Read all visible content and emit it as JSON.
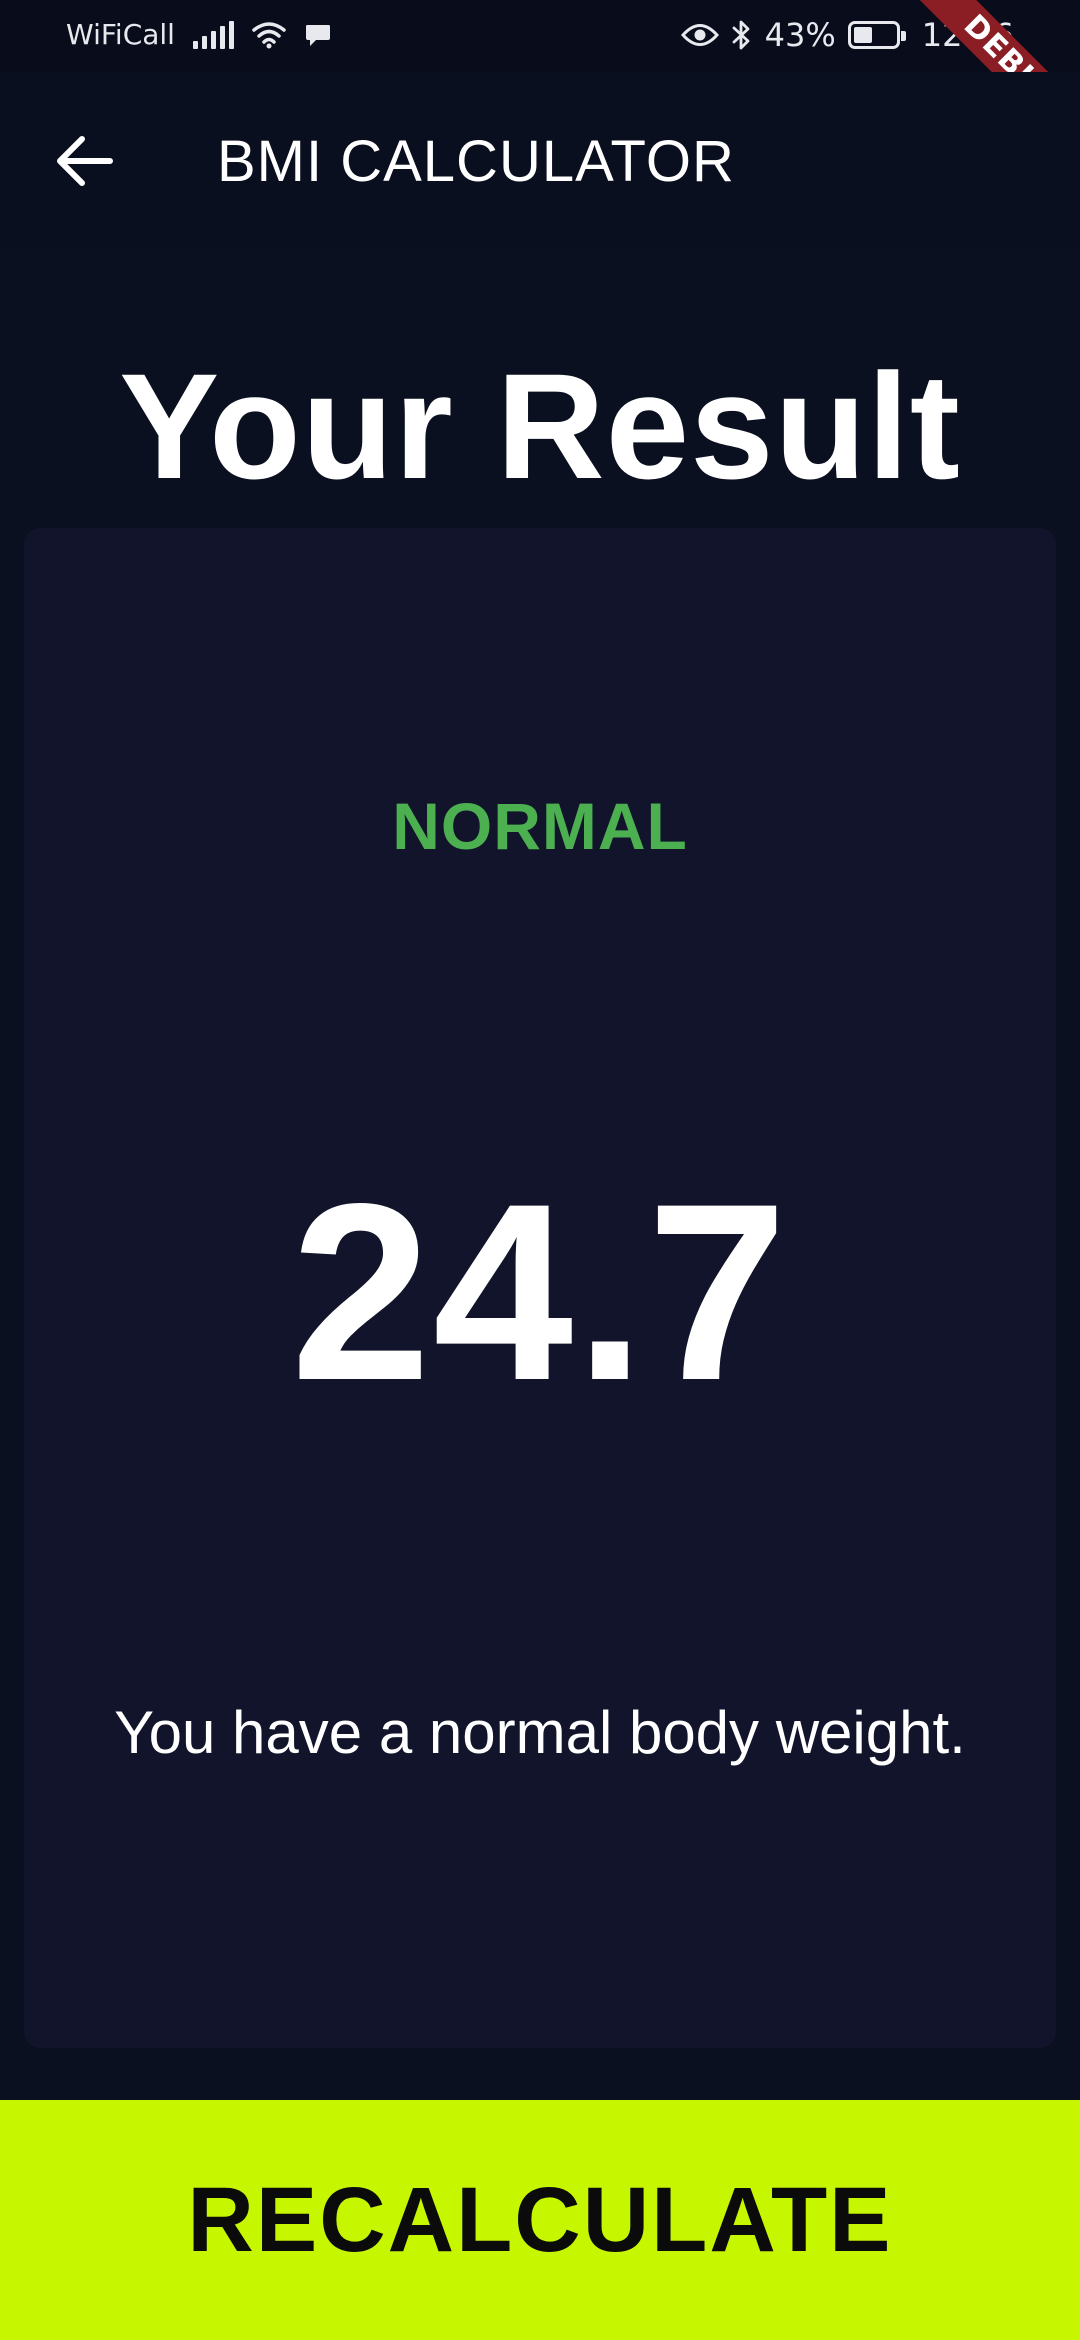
{
  "status_bar": {
    "carrier": "WiFiCall",
    "battery_percent": "43%",
    "time": "12:06",
    "icons": [
      "signal-icon",
      "wifi-icon",
      "message-icon",
      "eye-icon",
      "bluetooth-icon",
      "battery-icon"
    ]
  },
  "debug_banner": {
    "label": "DEBUG",
    "color": "#8b1e24"
  },
  "app_bar": {
    "back_icon": "arrow-left-icon",
    "title": "BMI CALCULATOR"
  },
  "page": {
    "heading": "Your Result"
  },
  "result": {
    "status": "NORMAL",
    "status_color": "#4caf50",
    "value": "24.7",
    "message": "You have a normal body weight."
  },
  "actions": {
    "recalculate_label": "RECALCULATE",
    "button_color": "#c6f600"
  }
}
